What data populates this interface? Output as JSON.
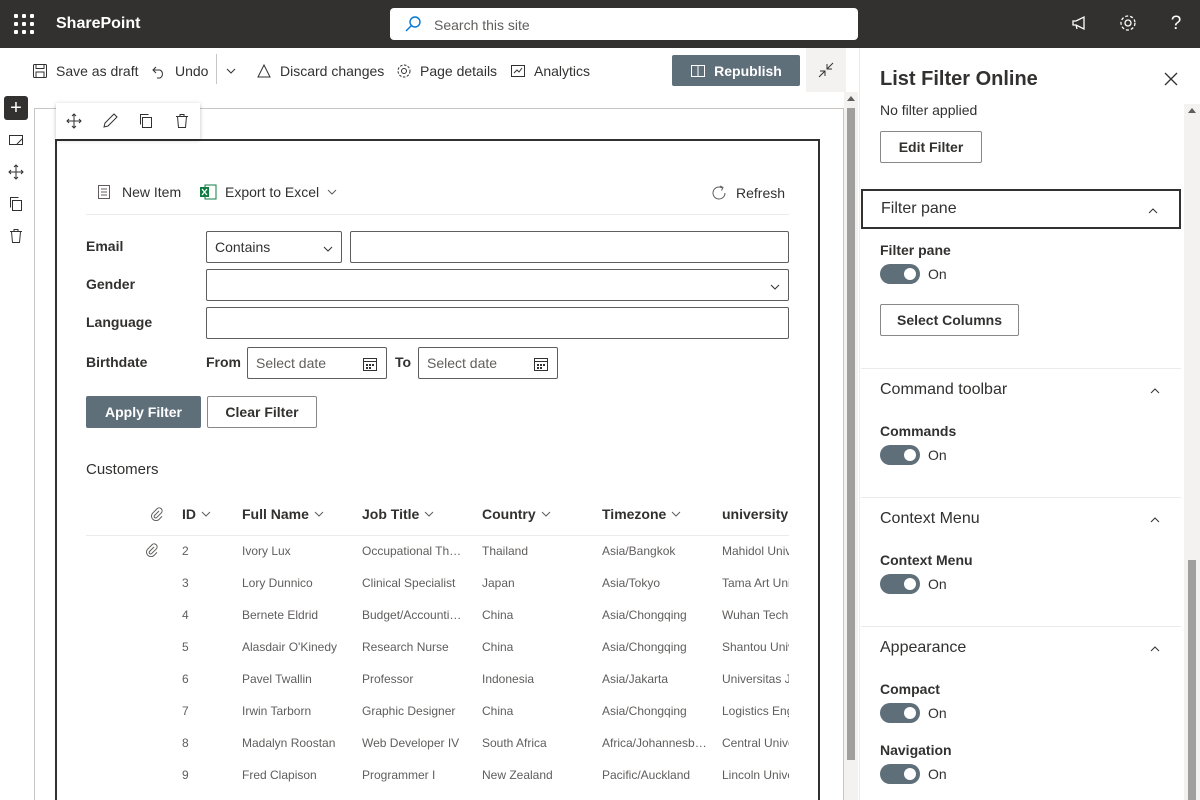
{
  "suitebar": {
    "brand": "SharePoint",
    "search_placeholder": "Search this site"
  },
  "cmdbar": {
    "save_draft": "Save as draft",
    "undo": "Undo",
    "discard": "Discard changes",
    "page_details": "Page details",
    "analytics": "Analytics",
    "republish": "Republish"
  },
  "webpart": {
    "new_item": "New Item",
    "export_excel": "Export to Excel",
    "refresh": "Refresh",
    "filters": {
      "email_label": "Email",
      "email_operator": "Contains",
      "email_value": "",
      "gender_label": "Gender",
      "gender_value": "",
      "language_label": "Language",
      "language_value": "",
      "birthdate_label": "Birthdate",
      "from_label": "From",
      "to_label": "To",
      "date_placeholder": "Select date"
    },
    "apply_filter": "Apply Filter",
    "clear_filter": "Clear Filter",
    "list_title": "Customers",
    "columns": [
      "ID",
      "Full Name",
      "Job Title",
      "Country",
      "Timezone",
      "university"
    ],
    "rows": [
      {
        "id": "2",
        "name": "Ivory Lux",
        "job": "Occupational Th…",
        "country": "Thailand",
        "tz": "Asia/Bangkok",
        "uni": "Mahidol Univ",
        "attach": true
      },
      {
        "id": "3",
        "name": "Lory Dunnico",
        "job": "Clinical Specialist",
        "country": "Japan",
        "tz": "Asia/Tokyo",
        "uni": "Tama Art Uni",
        "attach": false
      },
      {
        "id": "4",
        "name": "Bernete Eldrid",
        "job": "Budget/Accounti…",
        "country": "China",
        "tz": "Asia/Chongqing",
        "uni": "Wuhan Techn",
        "attach": false
      },
      {
        "id": "5",
        "name": "Alasdair O'Kinedy",
        "job": "Research Nurse",
        "country": "China",
        "tz": "Asia/Chongqing",
        "uni": "Shantou Univ",
        "attach": false
      },
      {
        "id": "6",
        "name": "Pavel Twallin",
        "job": "Professor",
        "country": "Indonesia",
        "tz": "Asia/Jakarta",
        "uni": "Universitas Ja",
        "attach": false
      },
      {
        "id": "7",
        "name": "Irwin Tarborn",
        "job": "Graphic Designer",
        "country": "China",
        "tz": "Asia/Chongqing",
        "uni": "Logistics Eng",
        "attach": false
      },
      {
        "id": "8",
        "name": "Madalyn Roostan",
        "job": "Web Developer IV",
        "country": "South Africa",
        "tz": "Africa/Johannesb…",
        "uni": "Central Unive",
        "attach": false
      },
      {
        "id": "9",
        "name": "Fred Clapison",
        "job": "Programmer I",
        "country": "New Zealand",
        "tz": "Pacific/Auckland",
        "uni": "Lincoln Unive",
        "attach": false
      }
    ]
  },
  "pane": {
    "title": "List Filter Online",
    "filter_status": "No filter applied",
    "edit_filter": "Edit Filter",
    "groups": {
      "filter_pane": {
        "header": "Filter pane",
        "toggle_label": "Filter pane",
        "toggle_state": "On",
        "select_columns": "Select Columns"
      },
      "command_toolbar": {
        "header": "Command toolbar",
        "toggle_label": "Commands",
        "toggle_state": "On"
      },
      "context_menu": {
        "header": "Context Menu",
        "toggle_label": "Context Menu",
        "toggle_state": "On"
      },
      "appearance": {
        "header": "Appearance",
        "compact_label": "Compact",
        "compact_state": "On",
        "navigation_label": "Navigation",
        "navigation_state": "On"
      }
    }
  },
  "colors": {
    "suitebar": "#323130",
    "accent": "#5f6f7a"
  }
}
